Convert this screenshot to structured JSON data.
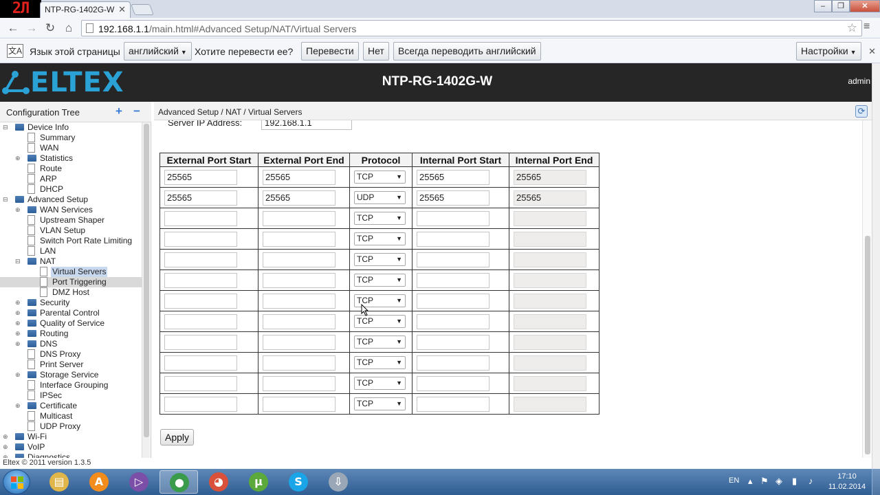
{
  "channel_logo": "2Л",
  "browser": {
    "tab_title": "NTP-RG-1402G-W",
    "url_host": "192.168.1.1",
    "url_path": "/main.html#Advanced Setup/NAT/Virtual Servers"
  },
  "translate_bar": {
    "page_language_label": "Язык этой страницы",
    "language_select": "английский",
    "prompt": "Хотите перевести ее?",
    "translate_button": "Перевести",
    "no_button": "Нет",
    "always_button": "Всегда переводить английский",
    "settings_button": "Настройки"
  },
  "header": {
    "logo_text": "ELTEX",
    "device_title": "NTP-RG-1402G-W",
    "user": "admin"
  },
  "tree": {
    "title": "Configuration Tree",
    "items": [
      {
        "label": "Device Info",
        "level": 0,
        "type": "folder",
        "toggle": "minus"
      },
      {
        "label": "Summary",
        "level": 1,
        "type": "doc"
      },
      {
        "label": "WAN",
        "level": 1,
        "type": "doc"
      },
      {
        "label": "Statistics",
        "level": 1,
        "type": "folder",
        "toggle": "plus"
      },
      {
        "label": "Route",
        "level": 1,
        "type": "doc"
      },
      {
        "label": "ARP",
        "level": 1,
        "type": "doc"
      },
      {
        "label": "DHCP",
        "level": 1,
        "type": "doc"
      },
      {
        "label": "Advanced Setup",
        "level": 0,
        "type": "folder",
        "toggle": "minus"
      },
      {
        "label": "WAN Services",
        "level": 1,
        "type": "folder",
        "toggle": "plus"
      },
      {
        "label": "Upstream Shaper",
        "level": 1,
        "type": "doc"
      },
      {
        "label": "VLAN Setup",
        "level": 1,
        "type": "doc"
      },
      {
        "label": "Switch Port Rate Limiting",
        "level": 1,
        "type": "doc"
      },
      {
        "label": "LAN",
        "level": 1,
        "type": "doc"
      },
      {
        "label": "NAT",
        "level": 1,
        "type": "folder",
        "toggle": "minus"
      },
      {
        "label": "Virtual Servers",
        "level": 2,
        "type": "doc",
        "selected": true
      },
      {
        "label": "Port Triggering",
        "level": 2,
        "type": "doc",
        "highlight": true
      },
      {
        "label": "DMZ Host",
        "level": 2,
        "type": "doc"
      },
      {
        "label": "Security",
        "level": 1,
        "type": "folder",
        "toggle": "plus"
      },
      {
        "label": "Parental Control",
        "level": 1,
        "type": "folder",
        "toggle": "plus"
      },
      {
        "label": "Quality of Service",
        "level": 1,
        "type": "folder",
        "toggle": "plus"
      },
      {
        "label": "Routing",
        "level": 1,
        "type": "folder",
        "toggle": "plus"
      },
      {
        "label": "DNS",
        "level": 1,
        "type": "folder",
        "toggle": "plus"
      },
      {
        "label": "DNS Proxy",
        "level": 1,
        "type": "doc"
      },
      {
        "label": "Print Server",
        "level": 1,
        "type": "doc"
      },
      {
        "label": "Storage Service",
        "level": 1,
        "type": "folder",
        "toggle": "plus"
      },
      {
        "label": "Interface Grouping",
        "level": 1,
        "type": "doc"
      },
      {
        "label": "IPSec",
        "level": 1,
        "type": "doc"
      },
      {
        "label": "Certificate",
        "level": 1,
        "type": "folder",
        "toggle": "plus"
      },
      {
        "label": "Multicast",
        "level": 1,
        "type": "doc"
      },
      {
        "label": "UDP Proxy",
        "level": 1,
        "type": "doc"
      },
      {
        "label": "Wi-Fi",
        "level": 0,
        "type": "folder",
        "toggle": "plus"
      },
      {
        "label": "VoIP",
        "level": 0,
        "type": "folder",
        "toggle": "plus"
      },
      {
        "label": "Diagnostics",
        "level": 0,
        "type": "folder",
        "toggle": "plus"
      }
    ]
  },
  "footer": "Eltex © 2011 version 1.3.5",
  "content": {
    "breadcrumb": "Advanced Setup / NAT / Virtual Servers",
    "server_ip_label": "Server IP Address:",
    "server_ip_value": "192.168.1.1",
    "columns": [
      "External Port Start",
      "External Port End",
      "Protocol",
      "Internal Port Start",
      "Internal Port End"
    ],
    "rows": [
      {
        "ext_start": "25565",
        "ext_end": "25565",
        "protocol": "TCP",
        "int_start": "25565",
        "int_end": "25565"
      },
      {
        "ext_start": "25565",
        "ext_end": "25565",
        "protocol": "UDP",
        "int_start": "25565",
        "int_end": "25565"
      },
      {
        "ext_start": "",
        "ext_end": "",
        "protocol": "TCP",
        "int_start": "",
        "int_end": ""
      },
      {
        "ext_start": "",
        "ext_end": "",
        "protocol": "TCP",
        "int_start": "",
        "int_end": ""
      },
      {
        "ext_start": "",
        "ext_end": "",
        "protocol": "TCP",
        "int_start": "",
        "int_end": ""
      },
      {
        "ext_start": "",
        "ext_end": "",
        "protocol": "TCP",
        "int_start": "",
        "int_end": ""
      },
      {
        "ext_start": "",
        "ext_end": "",
        "protocol": "TCP",
        "int_start": "",
        "int_end": ""
      },
      {
        "ext_start": "",
        "ext_end": "",
        "protocol": "TCP",
        "int_start": "",
        "int_end": ""
      },
      {
        "ext_start": "",
        "ext_end": "",
        "protocol": "TCP",
        "int_start": "",
        "int_end": ""
      },
      {
        "ext_start": "",
        "ext_end": "",
        "protocol": "TCP",
        "int_start": "",
        "int_end": ""
      },
      {
        "ext_start": "",
        "ext_end": "",
        "protocol": "TCP",
        "int_start": "",
        "int_end": ""
      },
      {
        "ext_start": "",
        "ext_end": "",
        "protocol": "TCP",
        "int_start": "",
        "int_end": ""
      }
    ],
    "apply_button": "Apply"
  },
  "taskbar": {
    "apps": [
      {
        "name": "file-explorer-icon",
        "color": "#e0b64a",
        "glyph": "▤"
      },
      {
        "name": "avast-icon",
        "color": "#f28c1c",
        "glyph": "A"
      },
      {
        "name": "visual-studio-icon",
        "color": "#7b4ea8",
        "glyph": "▷"
      },
      {
        "name": "chrome-icon",
        "color": "#3a9b4a",
        "glyph": "●",
        "active": true
      },
      {
        "name": "media-player-icon",
        "color": "#d9513a",
        "glyph": "◕"
      },
      {
        "name": "utorrent-icon",
        "color": "#5aa93a",
        "glyph": "µ"
      },
      {
        "name": "skype-icon",
        "color": "#1aa5e8",
        "glyph": "S"
      },
      {
        "name": "downloader-icon",
        "color": "#9aa7b6",
        "glyph": "⇩"
      }
    ],
    "language": "EN",
    "time": "17:10",
    "date": "11.02.2014"
  },
  "colors": {
    "header_bg": "#262626",
    "logo_blue": "#2aa2d6",
    "selected_tree_bg": "#d9d9d9",
    "taskbar_blue": "#2f5c92"
  }
}
